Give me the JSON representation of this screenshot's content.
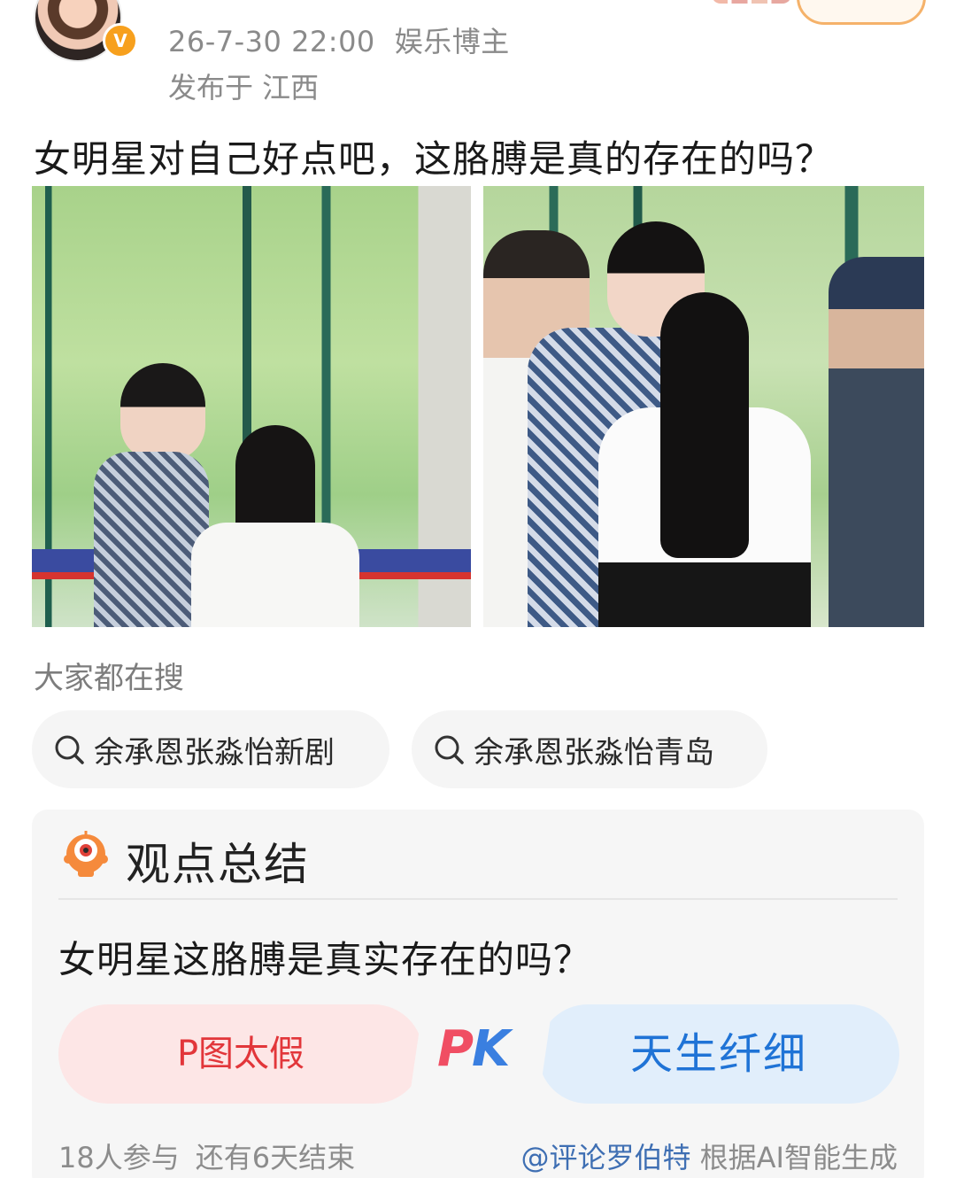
{
  "post": {
    "timestamp": "26-7-30 22:00",
    "author_tag": "娱乐博主",
    "location": "发布于 江西",
    "text": "女明星对自己好点吧，这胳膊是真的存在的吗？"
  },
  "search": {
    "title": "大家都在搜",
    "chips": [
      {
        "label": "余承恩张淼怡新剧",
        "icon": "search-icon"
      },
      {
        "label": "余承恩张淼怡青岛",
        "icon": "search-icon"
      }
    ]
  },
  "summary": {
    "title": "观点总结",
    "question": "女明星这胳膊是真实存在的吗？",
    "option_left": "P图太假",
    "pk_label": "PK",
    "option_right": "天生纤细",
    "participants": "18人参与",
    "remaining": "还有6天结束",
    "ai_handle": "@评论罗伯特",
    "ai_note": "根据AI智能生成",
    "colors": {
      "left": "#e2363a",
      "right": "#1f73d6"
    }
  }
}
